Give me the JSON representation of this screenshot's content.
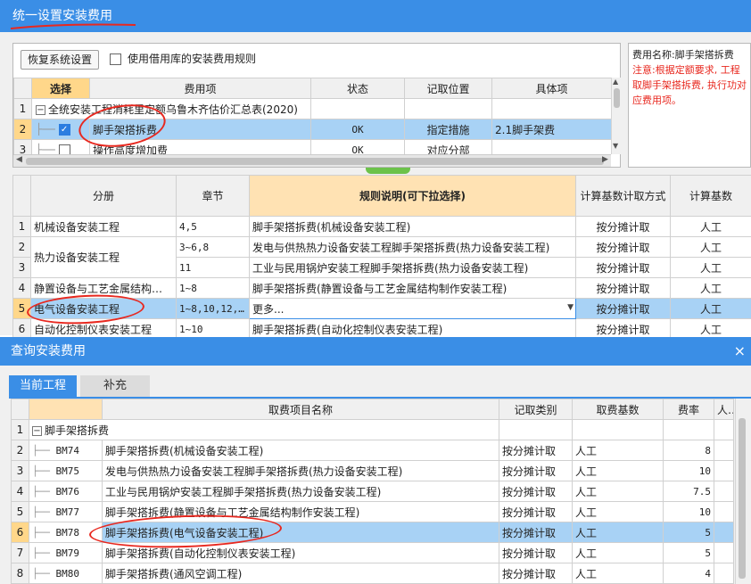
{
  "window": {
    "title": "统一设置安装费用"
  },
  "toolbar": {
    "restore_label": "恢复系统设置",
    "use_borrowed_label": "使用借用库的安装费用规则"
  },
  "top_grid": {
    "headers": [
      "选择",
      "费用项",
      "状态",
      "记取位置",
      "具体项"
    ],
    "rows": [
      {
        "num": "1",
        "item": "全统安装工程消耗里定额乌鲁木齐估价汇总表(2020)",
        "status": "",
        "position": "",
        "detail": ""
      },
      {
        "num": "2",
        "item": "脚手架搭拆费",
        "status": "OK",
        "position": "指定措施",
        "detail": "2.1脚手架费"
      },
      {
        "num": "3",
        "item": "操作高度增加费",
        "status": "OK",
        "position": "对应分部",
        "detail": ""
      }
    ]
  },
  "info": {
    "name_line": "费用名称:脚手架搭拆费",
    "note_line": "注意:根据定额要求, 工程取脚手架搭拆费, 执行功对应费用项。"
  },
  "rule_grid": {
    "headers": [
      "分册",
      "章节",
      "规则说明(可下拉选择)",
      "计算基数计取方式",
      "计算基数"
    ],
    "rows": [
      {
        "num": "1",
        "volume": "机械设备安装工程",
        "chapter": "4,5",
        "rule": "脚手架搭拆费(机械设备安装工程)",
        "method": "按分摊计取",
        "base": "人工"
      },
      {
        "num": "2",
        "volume": "热力设备安装工程",
        "chapter": "3~6,8",
        "rule": "发电与供热热力设备安装工程脚手架搭拆费(热力设备安装工程)",
        "method": "按分摊计取",
        "base": "人工"
      },
      {
        "num": "3",
        "volume": "",
        "chapter": "11",
        "rule": "工业与民用锅炉安装工程脚手架搭拆费(热力设备安装工程)",
        "method": "按分摊计取",
        "base": "人工"
      },
      {
        "num": "4",
        "volume": "静置设备与工艺金属结构…",
        "chapter": "1~8",
        "rule": "脚手架搭拆费(静置设备与工艺金属结构制作安装工程)",
        "method": "按分摊计取",
        "base": "人工"
      },
      {
        "num": "5",
        "volume": "电气设备安装工程",
        "chapter": "1~8,10,12,…",
        "rule": "更多...",
        "method": "按分摊计取",
        "base": "人工"
      },
      {
        "num": "6",
        "volume": "自动化控制仪表安装工程",
        "chapter": "1~10",
        "rule": "脚手架搭拆费(自动化控制仪表安装工程)",
        "method": "按分摊计取",
        "base": "人工"
      }
    ]
  },
  "dialog": {
    "title": "查询安装费用",
    "close": "×",
    "tabs": [
      "当前工程",
      "补充"
    ],
    "headers": [
      "取费项目名称",
      "记取类别",
      "取费基数",
      "费率",
      "人工"
    ],
    "rows": [
      {
        "num": "1",
        "code": "",
        "name": "脚手架搭拆费",
        "type": "",
        "base": "",
        "rate": ""
      },
      {
        "num": "2",
        "code": "BM74",
        "name": "脚手架搭拆费(机械设备安装工程)",
        "type": "按分摊计取",
        "base": "人工",
        "rate": "8"
      },
      {
        "num": "3",
        "code": "BM75",
        "name": "发电与供热热力设备安装工程脚手架搭拆费(热力设备安装工程)",
        "type": "按分摊计取",
        "base": "人工",
        "rate": "10"
      },
      {
        "num": "4",
        "code": "BM76",
        "name": "工业与民用锅炉安装工程脚手架搭拆费(热力设备安装工程)",
        "type": "按分摊计取",
        "base": "人工",
        "rate": "7.5"
      },
      {
        "num": "5",
        "code": "BM77",
        "name": "脚手架搭拆费(静置设备与工艺金属结构制作安装工程)",
        "type": "按分摊计取",
        "base": "人工",
        "rate": "10"
      },
      {
        "num": "6",
        "code": "BM78",
        "name": "脚手架搭拆费(电气设备安装工程)",
        "type": "按分摊计取",
        "base": "人工",
        "rate": "5"
      },
      {
        "num": "7",
        "code": "BM79",
        "name": "脚手架搭拆费(自动化控制仪表安装工程)",
        "type": "按分摊计取",
        "base": "人工",
        "rate": "5"
      },
      {
        "num": "8",
        "code": "BM80",
        "name": "脚手架搭拆费(通风空调工程)",
        "type": "按分摊计取",
        "base": "人工",
        "rate": "4"
      }
    ]
  },
  "colors": {
    "accent": "#3a8ee6",
    "selection": "#a8d2f5",
    "annotation": "#e8281f"
  }
}
